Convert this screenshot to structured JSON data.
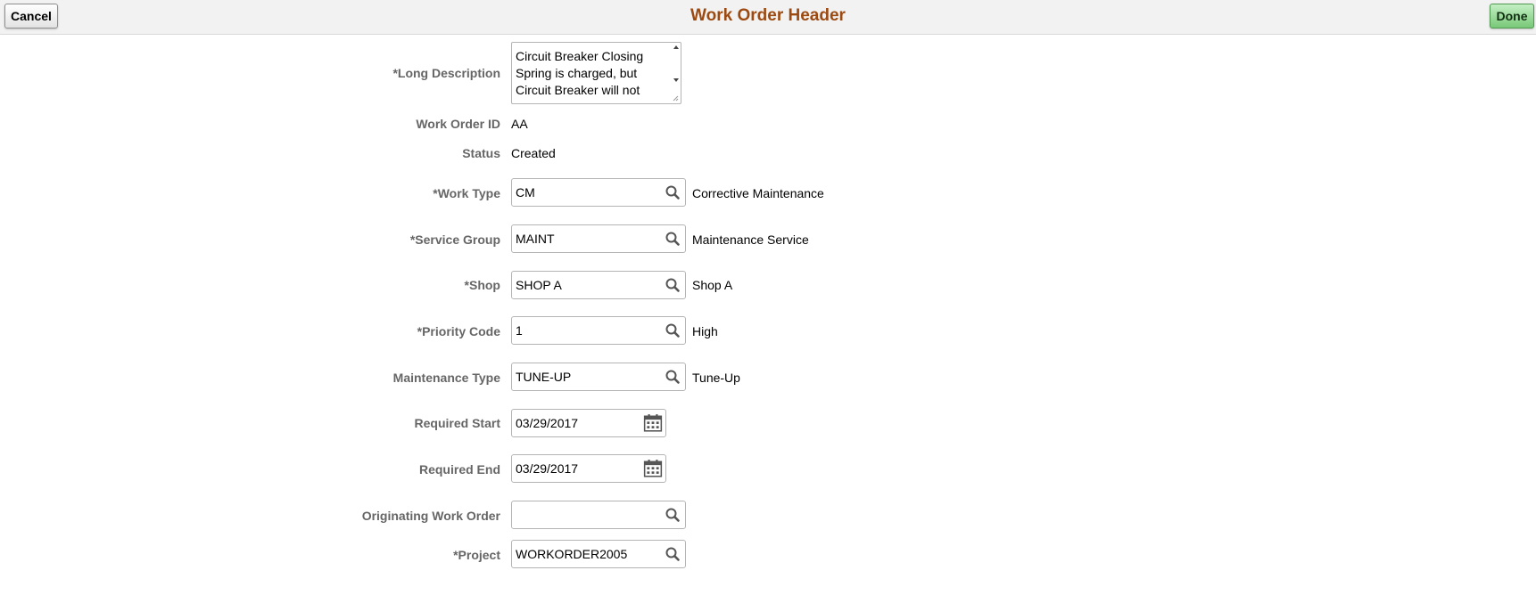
{
  "header": {
    "title": "Work Order Header",
    "cancel_label": "Cancel",
    "done_label": "Done"
  },
  "form": {
    "long_description": {
      "label": "*Long Description",
      "value": "Circuit Breaker Closing Spring is charged, but Circuit Breaker will not"
    },
    "work_order_id": {
      "label": "Work Order ID",
      "value": "AA"
    },
    "status": {
      "label": "Status",
      "value": "Created"
    },
    "work_type": {
      "label": "*Work Type",
      "value": "CM",
      "description": "Corrective Maintenance"
    },
    "service_group": {
      "label": "*Service Group",
      "value": "MAINT",
      "description": "Maintenance Service"
    },
    "shop": {
      "label": "*Shop",
      "value": "SHOP A",
      "description": "Shop A"
    },
    "priority_code": {
      "label": "*Priority Code",
      "value": "1",
      "description": "High"
    },
    "maintenance_type": {
      "label": "Maintenance Type",
      "value": "TUNE-UP",
      "description": "Tune-Up"
    },
    "required_start": {
      "label": "Required Start",
      "value": "03/29/2017"
    },
    "required_end": {
      "label": "Required End",
      "value": "03/29/2017"
    },
    "originating_work_order": {
      "label": "Originating Work Order",
      "value": ""
    },
    "project": {
      "label": "*Project",
      "value": "WORKORDER2005"
    }
  },
  "icons": {
    "lookup": "search-icon",
    "calendar": "calendar-icon"
  },
  "colors": {
    "title": "#9c4a11",
    "label": "#666666",
    "done_button": "#78c878"
  }
}
